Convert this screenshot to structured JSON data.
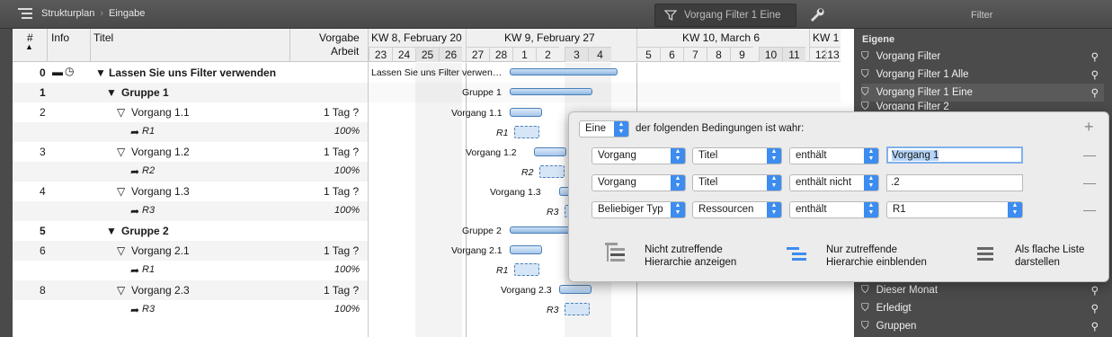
{
  "toolbar": {
    "breadcrumb_1": "Strukturplan",
    "breadcrumb_2": "Eingabe",
    "filter_button": "Vorgang Filter 1 Eine",
    "filter_title": "Filter"
  },
  "table": {
    "headers": {
      "num": "#",
      "info": "Info",
      "title": "Titel",
      "vorgabe": "Vorgabe",
      "arbeit": "Arbeit"
    },
    "rows": [
      {
        "num": "0",
        "title": "Lassen Sie uns Filter verwenden",
        "work": "",
        "bold": true,
        "kind": "group"
      },
      {
        "num": "1",
        "title": "Gruppe 1",
        "work": "",
        "bold": true,
        "kind": "group"
      },
      {
        "num": "2",
        "title": "Vorgang 1.1",
        "work": "1 Tag ?",
        "kind": "task"
      },
      {
        "num": "",
        "title": "R1",
        "work": "100%",
        "kind": "res"
      },
      {
        "num": "3",
        "title": "Vorgang 1.2",
        "work": "1 Tag ?",
        "kind": "task"
      },
      {
        "num": "",
        "title": "R2",
        "work": "100%",
        "kind": "res"
      },
      {
        "num": "4",
        "title": "Vorgang 1.3",
        "work": "1 Tag ?",
        "kind": "task"
      },
      {
        "num": "",
        "title": "R3",
        "work": "100%",
        "kind": "res"
      },
      {
        "num": "5",
        "title": "Gruppe 2",
        "work": "",
        "bold": true,
        "kind": "group"
      },
      {
        "num": "6",
        "title": "Vorgang 2.1",
        "work": "1 Tag ?",
        "kind": "task"
      },
      {
        "num": "",
        "title": "R1",
        "work": "100%",
        "kind": "res"
      },
      {
        "num": "8",
        "title": "Vorgang 2.3",
        "work": "1 Tag ?",
        "kind": "task"
      },
      {
        "num": "",
        "title": "R3",
        "work": "100%",
        "kind": "res"
      }
    ]
  },
  "gantt": {
    "weeks": [
      "KW 8, February 20",
      "KW 9, February 27",
      "KW 10, March 6",
      "KW 1"
    ],
    "days": [
      "23",
      "24",
      "25",
      "26",
      "27",
      "28",
      "1",
      "2",
      "3",
      "4",
      "5",
      "6",
      "7",
      "8",
      "9",
      "10",
      "11",
      "12",
      "13",
      "1"
    ],
    "labels": {
      "l0": "Lassen Sie uns Filter verwen…",
      "l1": "Gruppe 1",
      "l2": "Vorgang 1.1",
      "l3": "R1",
      "l4": "Vorgang 1.2",
      "l5": "R2",
      "l6": "Vorgang 1.3",
      "l7": "R3",
      "l8": "Gruppe 2",
      "l9": "Vorgang 2.1",
      "l10": "R1",
      "l11": "Vorgang 2.3",
      "l12": "R3"
    }
  },
  "sidebar": {
    "section": "Eigene",
    "items": [
      "Vorgang Filter",
      "Vorgang Filter 1 Alle",
      "Vorgang Filter 1 Eine",
      "Vorgang Filter 2",
      "Dieser Monat",
      "Erledigt",
      "Gruppen"
    ]
  },
  "popover": {
    "match_mode": "Eine",
    "match_text": "der folgenden Bedingungen ist wahr:",
    "conditions": [
      {
        "field": "Vorgang",
        "attr": "Titel",
        "op": "enthält",
        "value": "Vorgang 1"
      },
      {
        "field": "Vorgang",
        "attr": "Titel",
        "op": "enthält nicht",
        "value": ".2"
      },
      {
        "field": "Beliebiger Typ",
        "attr": "Ressourcen",
        "op": "enthält",
        "value": "R1"
      }
    ],
    "options": [
      {
        "line1": "Nicht zutreffende",
        "line2": "Hierarchie anzeigen"
      },
      {
        "line1": "Nur zutreffende",
        "line2": "Hierarchie einblenden"
      },
      {
        "line1": "Als flache Liste",
        "line2": "darstellen"
      }
    ]
  },
  "colors": {
    "accent": "#3d8cf0",
    "bar": "#8fb6e2"
  }
}
